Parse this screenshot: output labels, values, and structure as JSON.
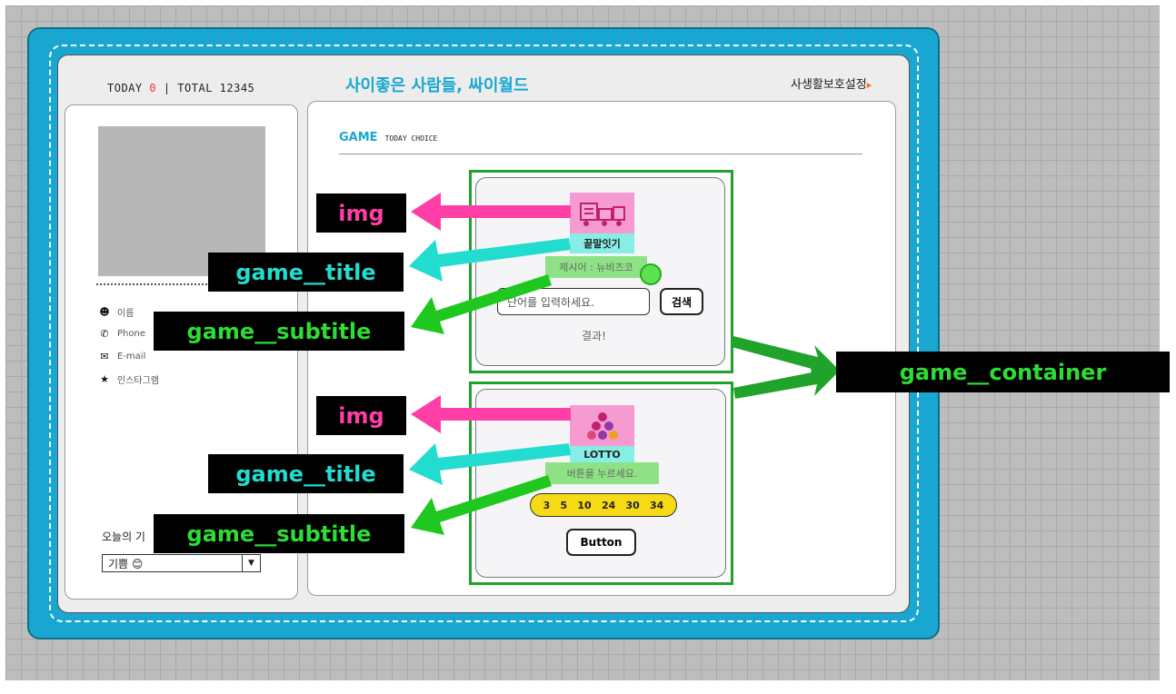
{
  "header": {
    "today_label": "TODAY",
    "today_value": "0",
    "separator": "|",
    "total_label": "TOTAL",
    "total_value": "12345",
    "site_title": "사이좋은 사람들, 싸이월드",
    "privacy_link": "사생활보호설정",
    "privacy_arrow": "▸"
  },
  "profile": {
    "info": [
      {
        "icon": "smiley-icon",
        "label": "이름"
      },
      {
        "icon": "phone-icon",
        "label": "Phone"
      },
      {
        "icon": "mail-icon",
        "label": "E-mail"
      },
      {
        "icon": "star-icon",
        "label": "인스타그램"
      }
    ],
    "mood_label": "오늘의 기",
    "mood_value": "기쁨 😊"
  },
  "game_section": {
    "title": "GAME",
    "subtitle": "TODAY CHOICE"
  },
  "word_game": {
    "title": "끝말잇기",
    "subtitle": "제시어 : 뉴비즈코",
    "input_placeholder": "단어를 입력하세요.",
    "search_button": "검색",
    "result": "결과!"
  },
  "lotto_game": {
    "title": "LOTTO",
    "subtitle": "버튼을 누르세요.",
    "numbers": [
      "3",
      "5",
      "10",
      "24",
      "30",
      "34"
    ],
    "button": "Button"
  },
  "annotations": {
    "img_1": "img",
    "title_1": "game__title",
    "subtitle_1": "game__subtitle",
    "img_2": "img",
    "title_2": "game__title",
    "subtitle_2": "game__subtitle",
    "container": "game__container"
  },
  "colors": {
    "brand": "#19a7d1",
    "img_label": "#ff3fa7",
    "title_label": "#22dccf",
    "subtitle_label": "#2ddc34",
    "container_outline": "#1fa32a"
  }
}
